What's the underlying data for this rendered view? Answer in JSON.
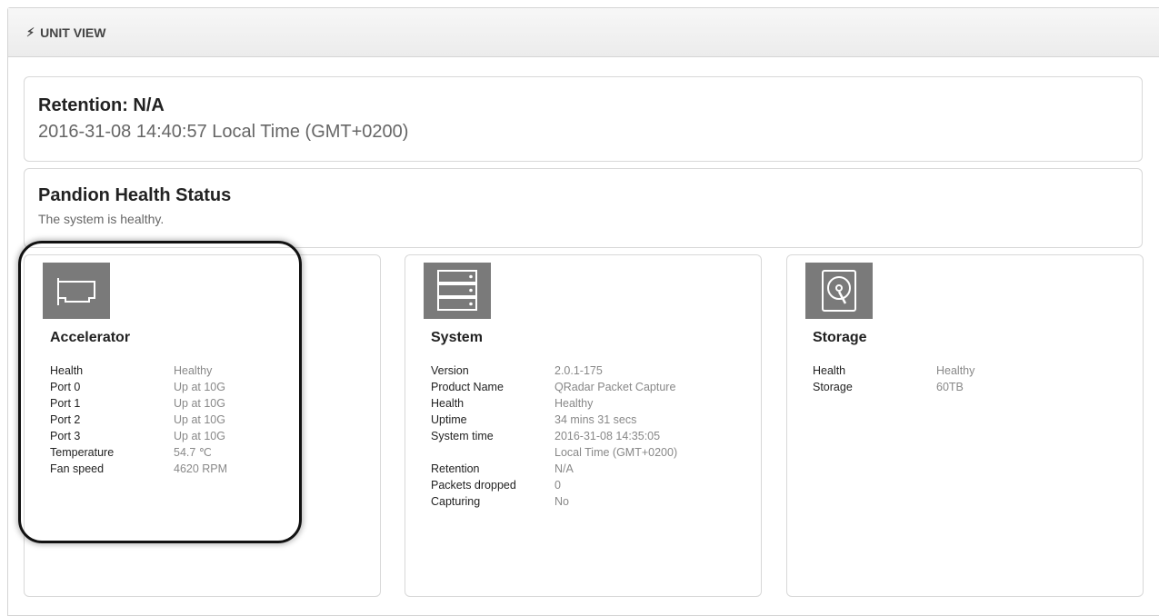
{
  "header": {
    "title": "UNIT VIEW",
    "icon": "bolt-icon"
  },
  "retention": {
    "title": "Retention: N/A",
    "time": "2016-31-08 14:40:57 Local Time (GMT+0200)"
  },
  "health": {
    "title": "Pandion Health Status",
    "message": "The system is healthy."
  },
  "cards": {
    "accelerator": {
      "title": "Accelerator",
      "icon": "accelerator-card-icon",
      "rows": [
        {
          "k": "Health",
          "v": "Healthy"
        },
        {
          "k": "Port 0",
          "v": "Up at 10G"
        },
        {
          "k": "Port 1",
          "v": "Up at 10G"
        },
        {
          "k": "Port 2",
          "v": "Up at 10G"
        },
        {
          "k": "Port 3",
          "v": "Up at 10G"
        },
        {
          "k": "Temperature",
          "v": "54.7 ℃"
        },
        {
          "k": "Fan speed",
          "v": "4620 RPM"
        }
      ]
    },
    "system": {
      "title": "System",
      "icon": "server-icon",
      "rows": [
        {
          "k": "Version",
          "v": "2.0.1-175"
        },
        {
          "k": "Product Name",
          "v": "QRadar Packet Capture"
        },
        {
          "k": "Health",
          "v": "Healthy"
        },
        {
          "k": "Uptime",
          "v": "34 mins 31 secs"
        },
        {
          "k": "System time",
          "v": "2016-31-08 14:35:05"
        },
        {
          "k": "",
          "v": "Local Time (GMT+0200)"
        },
        {
          "k": "Retention",
          "v": "N/A"
        },
        {
          "k": "Packets dropped",
          "v": "0"
        },
        {
          "k": "Capturing",
          "v": "No"
        }
      ]
    },
    "storage": {
      "title": "Storage",
      "icon": "hard-drive-icon",
      "rows": [
        {
          "k": "Health",
          "v": "Healthy"
        },
        {
          "k": "Storage",
          "v": "60TB"
        }
      ]
    }
  }
}
